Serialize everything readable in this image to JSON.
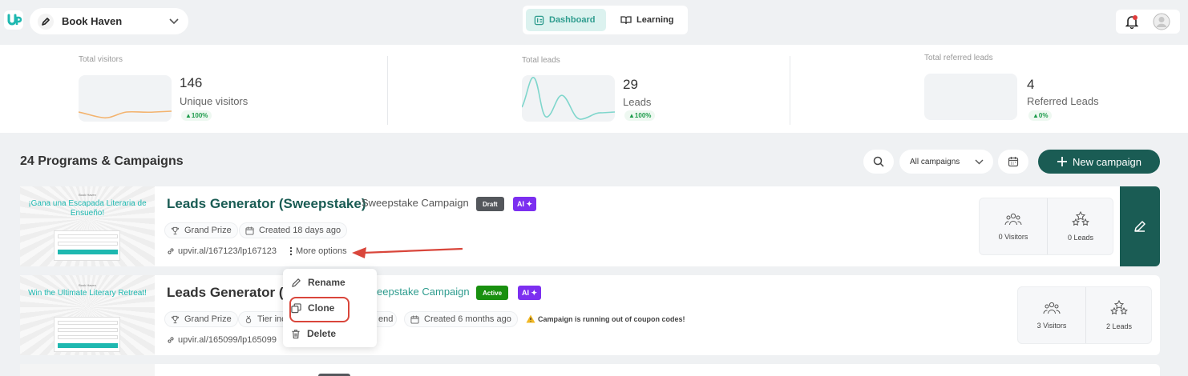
{
  "topbar": {
    "workspace_name": "Book Haven",
    "tabs": [
      {
        "label": "Dashboard",
        "active": true
      },
      {
        "label": "Learning",
        "active": false
      }
    ],
    "icons": [
      "upviral-logo-icon",
      "pencil-icon",
      "chevron-down-icon",
      "bell-icon",
      "avatar-icon"
    ]
  },
  "stats": [
    {
      "label": "Total visitors",
      "value": "146",
      "sub": "Unique visitors",
      "change": "100%"
    },
    {
      "label": "Total leads",
      "value": "29",
      "sub": "Leads",
      "change": "100%"
    },
    {
      "label": "Total referred leads",
      "value": "4",
      "sub": "Referred Leads",
      "change": "0%"
    }
  ],
  "section": {
    "title": "24 Programs & Campaigns",
    "filter_label": "All campaigns",
    "new_campaign_label": "New campaign"
  },
  "campaigns": [
    {
      "title": "Leads Generator (Sweepstake)",
      "type": "Sweepstake Campaign",
      "status": "Draft",
      "ai": "AI",
      "chips": [
        "Grand Prize",
        "Created 18 days ago"
      ],
      "url": "upvir.al/167123/lp167123",
      "more_options": "More options",
      "visitors": "0 Visitors",
      "leads": "0 Leads",
      "thumb": {
        "small": "Book Haven",
        "heading": "¡Gana una Escapada Literaria de Ensueño!"
      }
    },
    {
      "title_visible": "Leads Generator (S",
      "type_visible": "eepstake Campaign",
      "status": "Active",
      "ai": "AI",
      "chips": [
        "Grand Prize",
        "Tier inc",
        "end",
        "Created 6 months ago"
      ],
      "warning": "Campaign is running out of coupon codes!",
      "url": "upvir.al/165099/lp165099",
      "visitors": "3 Visitors",
      "leads": "2 Leads",
      "thumb": {
        "small": "Book Haven",
        "heading": "Win the Ultimate Literary Retreat!"
      }
    }
  ],
  "context_menu": {
    "items": [
      {
        "label": "Rename",
        "icon": "pencil-icon"
      },
      {
        "label": "Clone",
        "icon": "copy-icon",
        "highlighted": true
      },
      {
        "label": "Delete",
        "icon": "trash-icon"
      }
    ]
  },
  "colors": {
    "brand": "#1a5c54",
    "accent": "#2e9c8e",
    "draft": "#54575c",
    "active": "#19900f",
    "ai": "#7c2ff0",
    "highlight": "#d9463b"
  }
}
